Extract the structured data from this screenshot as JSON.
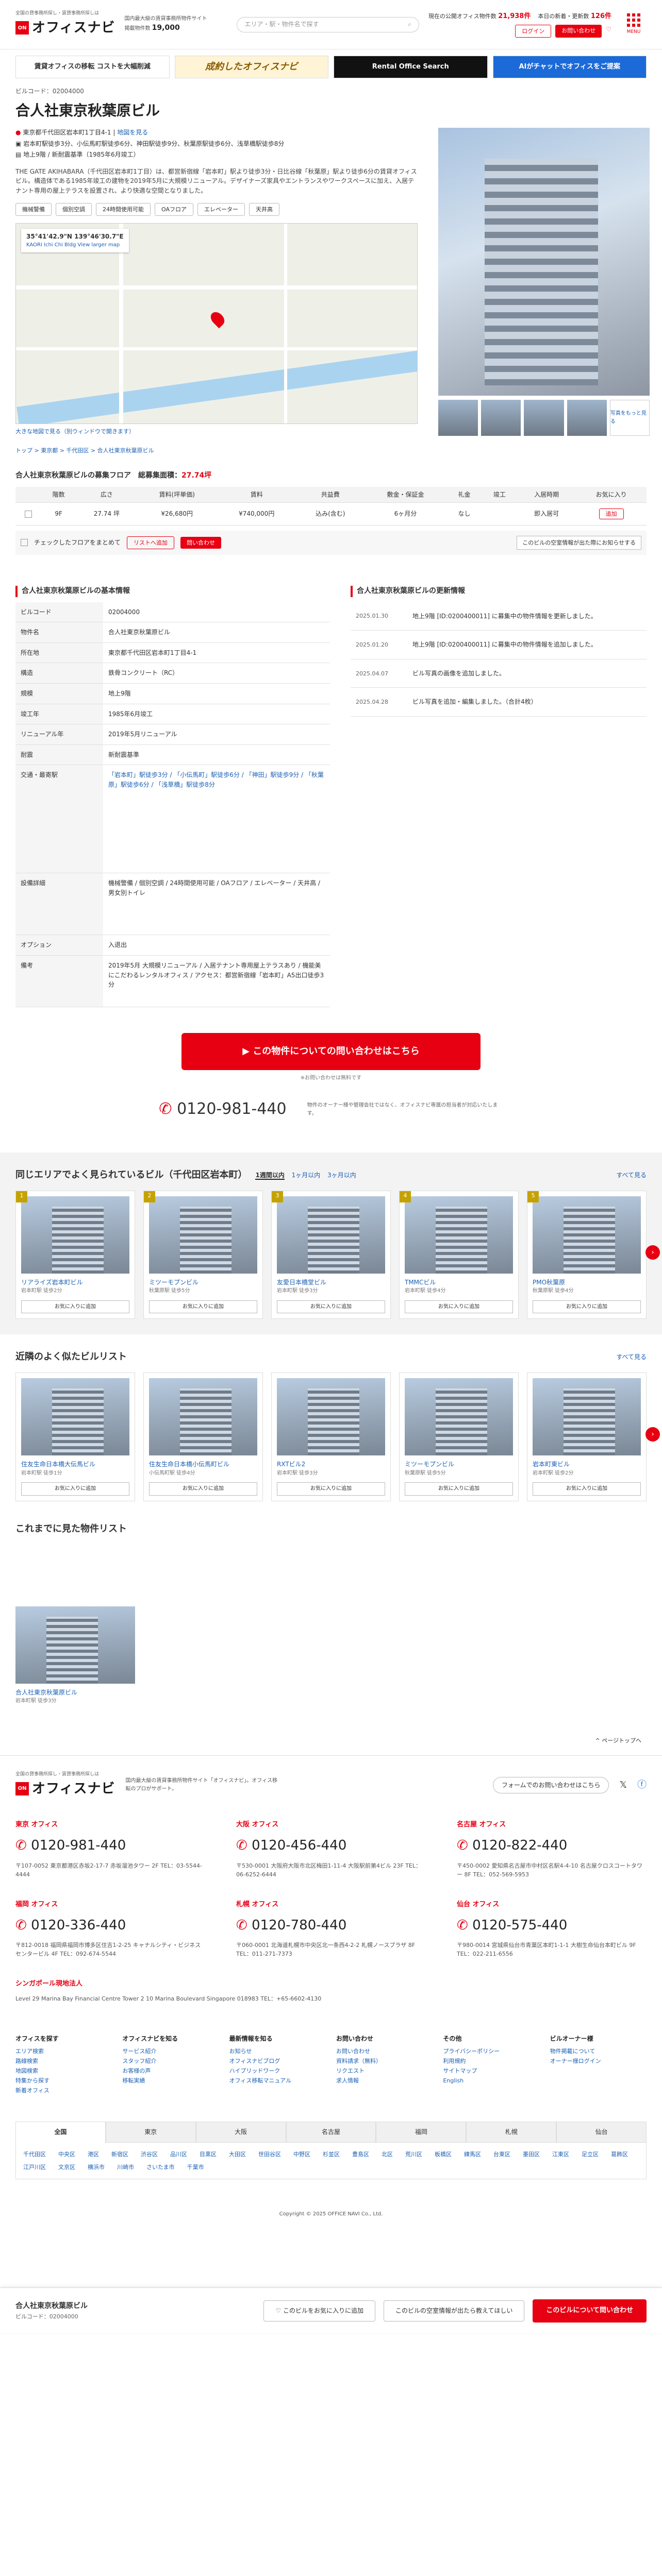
{
  "header": {
    "tagline": "全国の貸事務所探し・賃貸事務所探しは",
    "logo_badge": "officenavi",
    "logo_text": "オフィスナビ",
    "desc_line": "国内最大級の賃貸事務所物件サイト",
    "desc_count_label": "掲載物件数",
    "desc_count": "19,000",
    "search_placeholder": "エリア・駅・物件名で探す",
    "stat1_label": "現在の公開オフィス物件数",
    "stat1_value": "21,938件",
    "stat2_label": "本日の新着・更新数",
    "stat2_value": "126件",
    "login": "ログイン",
    "contact": "お問い合わせ",
    "menu": "MENU"
  },
  "banners": [
    "賃貸オフィスの移転 コストを大幅削減",
    "成約したオフィスナビ",
    "Rental Office Search",
    "AIがチャットでオフィスをご提案"
  ],
  "property": {
    "code_label": "ビルコード",
    "code": "02004000",
    "name": "合人社東京秋葉原ビル",
    "address": "東京都千代田区岩本町1丁目4-1",
    "address_link": "地図を見る",
    "stations": "岩本町駅徒歩3分、小伝馬町駅徒歩6分、神田駅徒歩9分、秋葉原駅徒歩6分、浅草橋駅徒歩8分",
    "building": "地上9階 / 新耐震基準（1985年6月竣工）",
    "description": "THE GATE AKIHABARA（千代田区岩本町1丁目）は、都営新宿線「岩本町」駅より徒歩3分・日比谷線「秋葉原」駅より徒歩6分の賃貸オフィスビル。構造体である1985年竣工の建物を2019年5月に大規模リニューアル。デザイナーズ家具やエントランスやワークスペースに加え、入居テナント専用の屋上テラスを設置され、より快適な空間となりました。",
    "tags": [
      "機械警備",
      "個別空調",
      "24時間使用可能",
      "OAフロア",
      "エレベーター",
      "天井高"
    ],
    "map_coord": "35°41'42.9\"N 139°46'30.7\"E",
    "map_sub": "KAORI Ichi Chi Bldg View larger map",
    "map_link": "大きな地図で見る（別ウィンドウで開きます）",
    "more_photos": "写真をもっと見る"
  },
  "breadcrumb": "トップ > 東京都 > 千代田区 > 合人社東京秋葉原ビル",
  "vacancy": {
    "title": "合人社東京秋葉原ビルの募集フロア",
    "total_label": "総募集面積：",
    "total": "27.74坪",
    "headers": [
      "階数",
      "広さ",
      "賃料(坪単価)",
      "賃料",
      "共益費",
      "敷金・保証金",
      "礼金",
      "竣工",
      "入居時期",
      "お気に入り"
    ],
    "rows": [
      {
        "floor": "9F",
        "area": "27.74 坪",
        "rent_tsubo": "¥26,680円",
        "rent": "¥740,000円",
        "common": "込み(含む)",
        "deposit": "6ヶ月分",
        "key": "なし",
        "built": "",
        "move_in": "即入居可",
        "fav": "追加"
      }
    ],
    "check_all": "チェックしたフロアをまとめて",
    "btn_list": "リストへ追加",
    "btn_inquiry": "問い合わせ",
    "note": "このビルの空室情報が出た際にお知らせする"
  },
  "specs": {
    "title": "合人社東京秋葉原ビルの基本情報",
    "rows": [
      {
        "k": "ビルコード",
        "v": "02004000"
      },
      {
        "k": "物件名",
        "v": "合人社東京秋葉原ビル"
      },
      {
        "k": "所在地",
        "v": "東京都千代田区岩本町1丁目4-1"
      },
      {
        "k": "構造",
        "v": "鉄骨コンクリート（RC）"
      },
      {
        "k": "規模",
        "v": "地上9階"
      },
      {
        "k": "竣工年",
        "v": "1985年6月竣工"
      },
      {
        "k": "リニューアル年",
        "v": "2019年5月リニューアル"
      },
      {
        "k": "耐震",
        "v": "新耐震基準"
      },
      {
        "k": "交通・最寄駅",
        "v": "「岩本町」駅徒歩3分 / 「小伝馬町」駅徒歩6分 / 「神田」駅徒歩9分 / 「秋葉原」駅徒歩6分 / 「浅草橋」駅徒歩8分"
      },
      {
        "k": "設備詳細",
        "v": "機械警備 / 個別空調 / 24時間使用可能 / OAフロア / エレベーター / 天井高 / 男女別トイレ"
      },
      {
        "k": "オプション",
        "v": "入退出"
      },
      {
        "k": "備考",
        "v": "2019年5月 大規模リニューアル / 入居テナント専用屋上テラスあり / 機能美にこだわるレンタルオフィス / アクセス：都営新宿線「岩本町」A5出口徒歩3分"
      }
    ]
  },
  "history": {
    "title": "合人社東京秋葉原ビルの更新情報",
    "rows": [
      {
        "date": "2025.01.30",
        "text": "地上9階 [ID:0200400011] に募集中の物件情報を更新しました。"
      },
      {
        "date": "2025.01.20",
        "text": "地上9階 [ID:0200400011] に募集中の物件情報を追加しました。"
      },
      {
        "date": "2025.04.07",
        "text": "ビル写真の画像を追加しました。"
      },
      {
        "date": "2025.04.28",
        "text": "ビル写真を追加・編集しました。（合計4枚）"
      }
    ]
  },
  "inquiry": {
    "button": "この物件についての問い合わせはこちら",
    "note": "※お問い合わせは無料です",
    "tel": "0120-981-440",
    "tel_note": "物件のオーナー様や管理会社ではなく、オフィスナビ専属の担当者が対応いたします。"
  },
  "popular": {
    "title": "同じエリアでよく見られているビル（千代田区岩本町）",
    "periods": [
      "1週間以内",
      "1ヶ月以内",
      "3ヶ月以内"
    ],
    "more": "すべて見る",
    "cards": [
      {
        "rank": "1",
        "name": "リアライズ岩本町ビル",
        "sub": "岩本町駅 徒歩2分"
      },
      {
        "rank": "2",
        "name": "ミツーモプンビル",
        "sub": "秋葉原駅 徒歩5分"
      },
      {
        "rank": "3",
        "name": "友愛日本橋堂ビル",
        "sub": "岩本町駅 徒歩3分"
      },
      {
        "rank": "4",
        "name": "TMMCビル",
        "sub": "岩本町駅 徒歩4分"
      },
      {
        "rank": "5",
        "name": "PMO秋葉原",
        "sub": "秋葉原駅 徒歩4分"
      }
    ],
    "fav": "お気に入りに追加"
  },
  "nearby": {
    "title": "近隣のよく似たビルリスト",
    "more": "すべて見る",
    "cards": [
      {
        "name": "住友生命日本橋大伝馬ビル",
        "sub": "岩本町駅 徒歩1分"
      },
      {
        "name": "住友生命日本橋小伝馬町ビル",
        "sub": "小伝馬町駅 徒歩4分"
      },
      {
        "name": "RXTビル2",
        "sub": "岩本町駅 徒歩3分"
      },
      {
        "name": "ミツーモプンビル",
        "sub": "秋葉原駅 徒歩5分"
      },
      {
        "name": "岩本町東ビル",
        "sub": "岩本町駅 徒歩2分"
      }
    ],
    "fav": "お気に入りに追加"
  },
  "viewed": {
    "title": "これまでに見た物件リスト",
    "card": {
      "name": "合人社東京秋葉原ビル",
      "sub": "岩本町駅 徒歩3分"
    }
  },
  "sticky": {
    "name": "合人社東京秋葉原ビル",
    "code": "ビルコード：02004000",
    "btn1": "このビルをお気に入りに追加",
    "btn2": "このビルの空室情報が出たら教えてほしい",
    "btn3": "このビルについて問い合わせ"
  },
  "pagetop": "ページトップへ",
  "footer": {
    "tagline": "全国の貸事務所探し・賃貸事務所探しは",
    "logo_text": "オフィスナビ",
    "desc": "国内最大級の賃貸事務所物件サイト「オフィスナビ」。オフィス移転のプロがサポート。",
    "form_link": "フォームでのお問い合わせはこちら",
    "offices": [
      {
        "name": "東京 オフィス",
        "tel": "0120-981-440",
        "adr": "〒107-0052 東京都港区赤坂2-17-7 赤坂溜池タワー 2F TEL：03-5544-4444"
      },
      {
        "name": "大阪 オフィス",
        "tel": "0120-456-440",
        "adr": "〒530-0001 大阪府大阪市北区梅田1-11-4 大阪駅前第4ビル 23F TEL：06-6252-6444"
      },
      {
        "name": "名古屋 オフィス",
        "tel": "0120-822-440",
        "adr": "〒450-0002 愛知県名古屋市中村区名駅4-4-10 名古屋クロスコートタワー 8F TEL：052-569-5953"
      },
      {
        "name": "福岡 オフィス",
        "tel": "0120-336-440",
        "adr": "〒812-0018 福岡県福岡市博多区住吉1-2-25 キャナルシティ・ビジネスセンタービル 4F TEL：092-674-5544"
      },
      {
        "name": "札幌 オフィス",
        "tel": "0120-780-440",
        "adr": "〒060-0001 北海道札幌市中央区北一条西4-2-2 札幌ノースプラザ 8F TEL：011-271-7373"
      },
      {
        "name": "仙台 オフィス",
        "tel": "0120-575-440",
        "adr": "〒980-0014 宮城県仙台市青葉区本町1-1-1 大樹生命仙台本町ビル 9F TEL：022-211-6556"
      }
    ],
    "sg_name": "シンガポール現地法人",
    "sg_adr": "Level 29 Marina Bay Financial Centre Tower 2 10 Marina Boulevard Singapore 018983 TEL：+65-6602-4130",
    "link_cols": [
      {
        "h": "オフィスを探す",
        "items": [
          "エリア検索",
          "路線検索",
          "地図検索",
          "特集から探す",
          "新着オフィス"
        ]
      },
      {
        "h": "オフィスナビを知る",
        "items": [
          "サービス紹介",
          "スタッフ紹介",
          "お客様の声",
          "移転実績"
        ]
      },
      {
        "h": "最新情報を知る",
        "items": [
          "お知らせ",
          "オフィスナビブログ",
          "ハイブリッドワーク",
          "オフィス移転マニュアル"
        ]
      },
      {
        "h": "お問い合わせ",
        "items": [
          "お問い合わせ",
          "資料請求（無料）",
          "リクエスト",
          "求人情報"
        ]
      },
      {
        "h": "その他",
        "items": [
          "プライバシーポリシー",
          "利用規約",
          "サイトマップ",
          "English"
        ]
      },
      {
        "h": "ビルオーナー様",
        "items": [
          "物件掲載について",
          "オーナー様ログイン"
        ]
      }
    ],
    "area_tabs": [
      "全国",
      "東京",
      "大阪",
      "名古屋",
      "福岡",
      "札幌",
      "仙台"
    ],
    "areas": [
      "千代田区",
      "中央区",
      "港区",
      "新宿区",
      "渋谷区",
      "品川区",
      "目黒区",
      "大田区",
      "世田谷区",
      "中野区",
      "杉並区",
      "豊島区",
      "北区",
      "荒川区",
      "板橋区",
      "練馬区",
      "台東区",
      "墨田区",
      "江東区",
      "足立区",
      "葛飾区",
      "江戸川区",
      "文京区",
      "横浜市",
      "川崎市",
      "さいたま市",
      "千葉市"
    ],
    "copyright": "Copyright © 2025 OFFICE NAVI Co., Ltd."
  }
}
